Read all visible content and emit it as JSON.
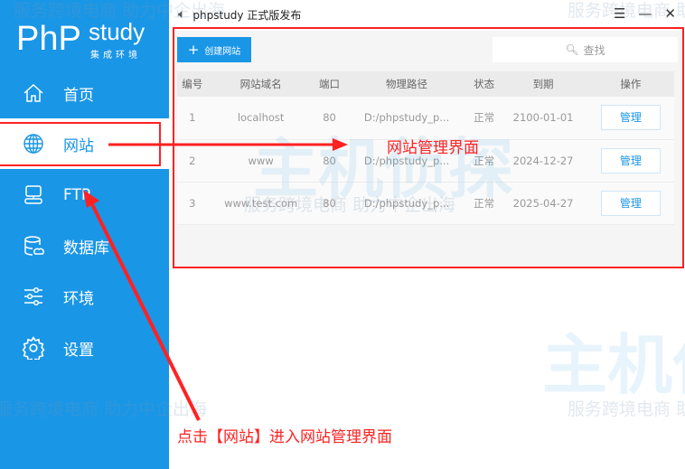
{
  "sidebar": {
    "logo_php": "PhP",
    "logo_study": "study",
    "logo_sub": "集成环境",
    "items": [
      {
        "label": "首页",
        "icon": "home-icon"
      },
      {
        "label": "网站",
        "icon": "globe-icon"
      },
      {
        "label": "FTP",
        "icon": "ftp-server-icon"
      },
      {
        "label": "数据库",
        "icon": "database-icon"
      },
      {
        "label": "环境",
        "icon": "sliders-icon"
      },
      {
        "label": "设置",
        "icon": "gear-icon"
      }
    ]
  },
  "titlebar": {
    "title": "phpstudy 正式版发布"
  },
  "toolbar": {
    "create_label": "创建网站",
    "search_placeholder": "查找"
  },
  "table": {
    "headers": [
      "编号",
      "网站域名",
      "端口",
      "物理路径",
      "状态",
      "到期",
      "操作"
    ],
    "rows": [
      [
        "1",
        "localhost",
        "80",
        "D:/phpstudy_p...",
        "正常",
        "2100-01-01",
        "管理"
      ],
      [
        "2",
        "www",
        "80",
        "D:/phpstudy_p...",
        "正常",
        "2024-12-27",
        "管理"
      ],
      [
        "3",
        "www.test.com",
        "80",
        "D:/phpstudy_p...",
        "正常",
        "2025-04-27",
        "管理"
      ]
    ]
  },
  "annotations": {
    "panel_label": "网站管理界面",
    "instruction": "点击【网站】进入网站管理界面"
  },
  "watermark": {
    "slogan": "服务跨境电商 助力中企出海",
    "brand": "主机侦探"
  },
  "colors": {
    "accent": "#1a96e6",
    "annotation": "#ff2222"
  }
}
